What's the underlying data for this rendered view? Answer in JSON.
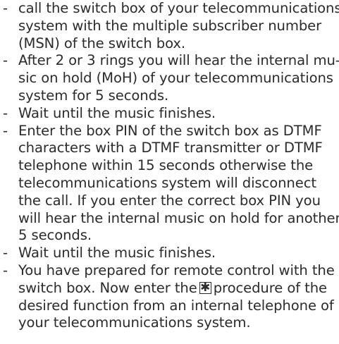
{
  "steps": [
    {
      "lines": [
        "call the switch box of your telecommunications",
        "system with the multiple subscriber number",
        "(MSN) of the switch box."
      ]
    },
    {
      "lines": [
        "After 2 or 3 rings you will hear the internal mu-",
        "sic on hold (MoH) of your telecommunications",
        "system for 5 seconds."
      ]
    },
    {
      "lines": [
        "Wait until the music finishes."
      ]
    },
    {
      "lines": [
        "Enter the box PIN of the switch box as DTMF",
        "characters with a DTMF transmitter or DTMF",
        "telephone within 15 seconds otherwise the",
        "telecommunications system will disconnect",
        "the call. If you enter the correct box PIN you",
        "will hear the internal music on hold for another",
        "5 seconds."
      ]
    },
    {
      "lines": [
        "Wait until the music finishes."
      ]
    },
    {
      "lines": [
        "You have prepared for remote control with the",
        "switch box. Now enter the",
        "procedure of the",
        "desired function from an internal telephone of",
        "your telecommunications system."
      ],
      "star_key_icon": "star-key-icon",
      "star_key_symbol": "✱"
    }
  ],
  "bullet": "-"
}
